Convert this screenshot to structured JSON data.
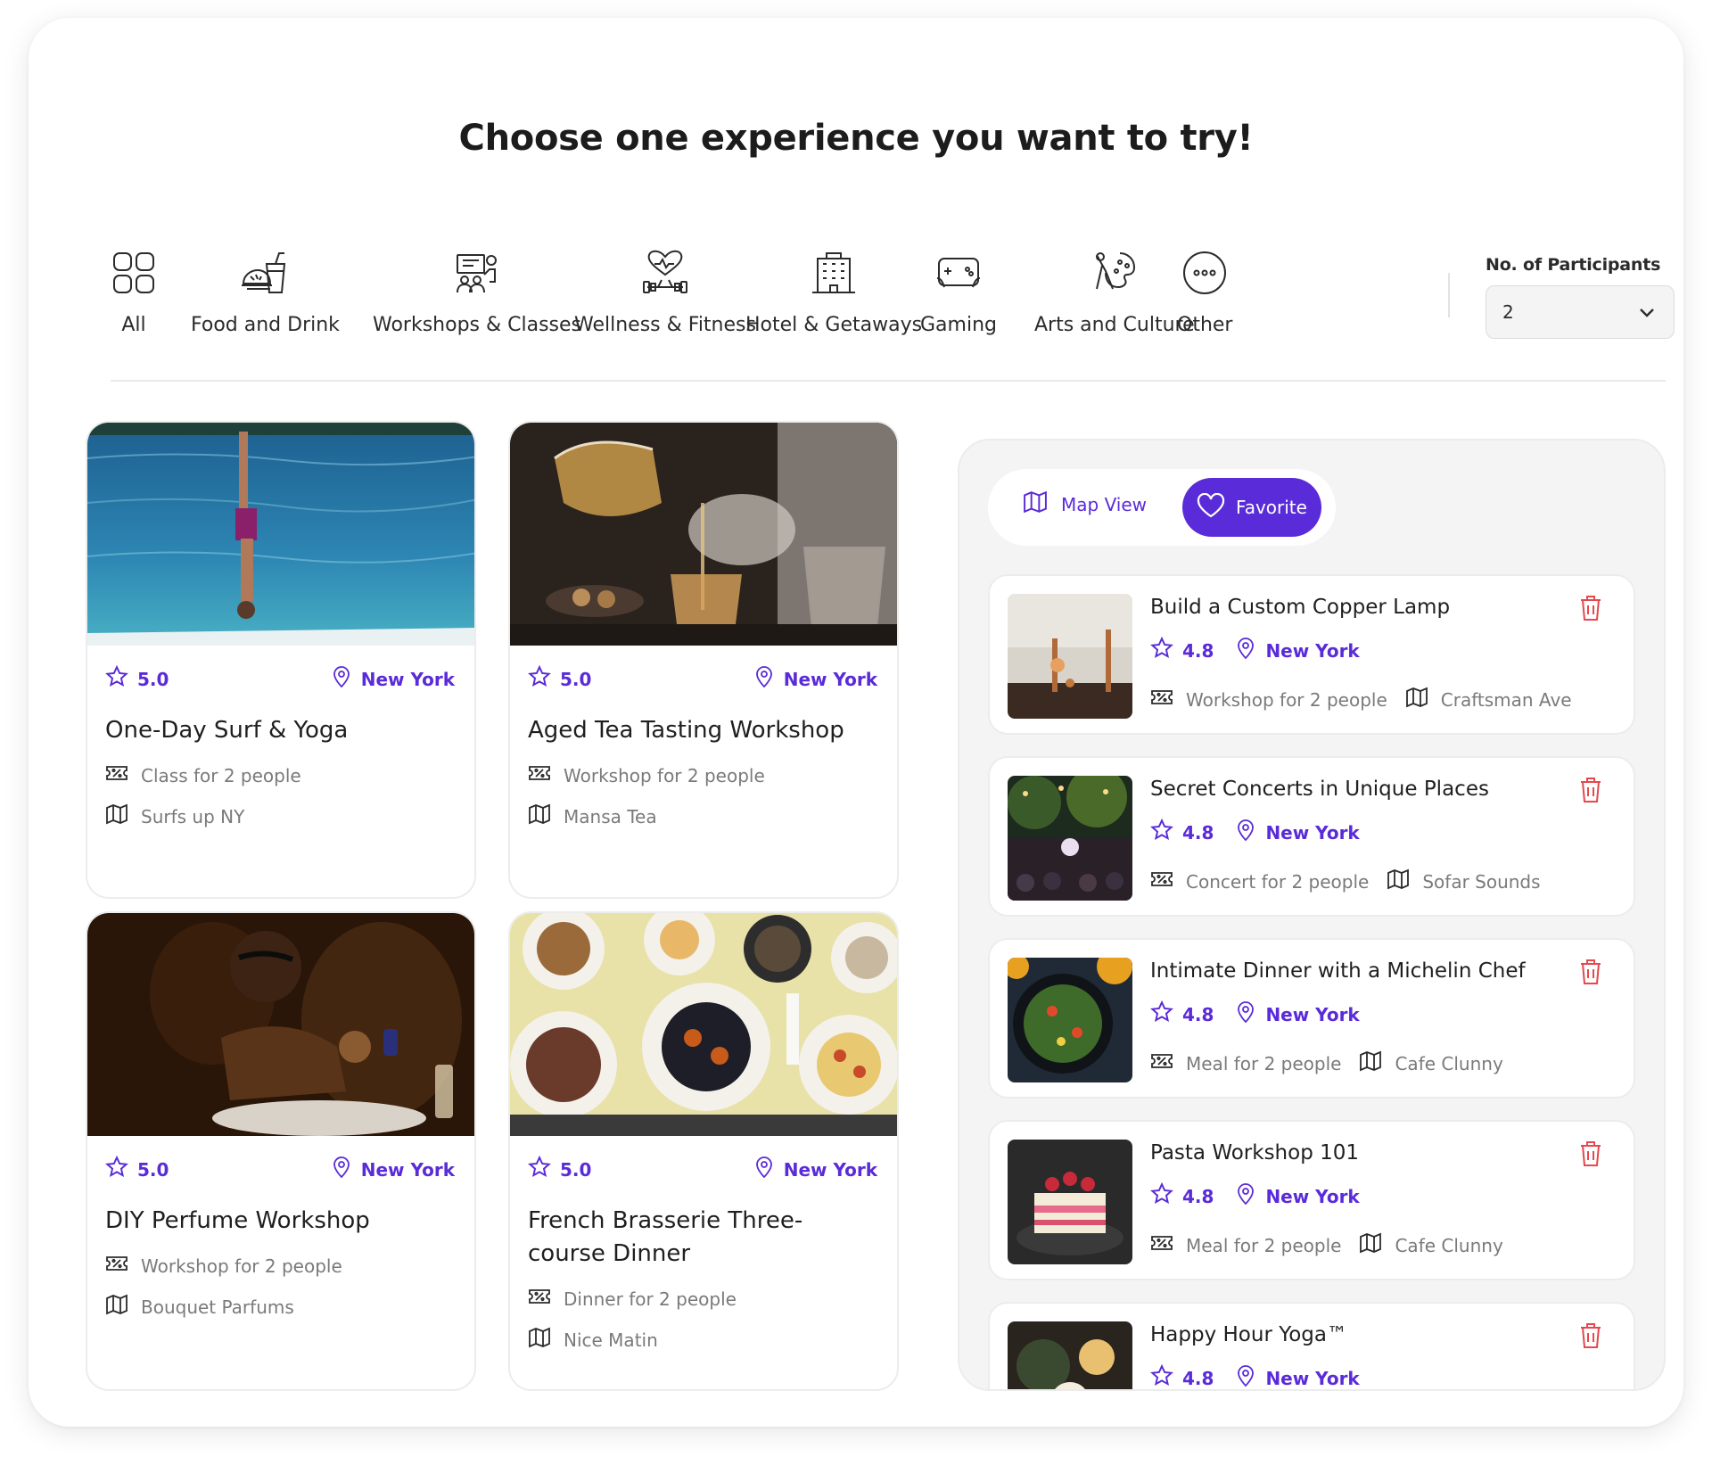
{
  "page_title": "Choose one experience you want to try!",
  "categories": [
    {
      "label": "All",
      "icon": "grid-icon"
    },
    {
      "label": "Food and Drink",
      "icon": "food-drink-icon"
    },
    {
      "label": "Workshops & Classes",
      "icon": "workshop-icon"
    },
    {
      "label": "Wellness & Fitness",
      "icon": "wellness-icon"
    },
    {
      "label": "Hotel & Getaways",
      "icon": "hotel-icon"
    },
    {
      "label": "Gaming",
      "icon": "gaming-icon"
    },
    {
      "label": "Arts and Culture",
      "icon": "arts-icon"
    },
    {
      "label": "Other",
      "icon": "more-icon"
    }
  ],
  "participants": {
    "label": "No. of Participants",
    "value": "2"
  },
  "cards": [
    {
      "rating": "5.0",
      "location": "New York",
      "title": "One-Day Surf & Yoga",
      "type": "Class for 2 people",
      "venue": "Surfs up NY"
    },
    {
      "rating": "5.0",
      "location": "New York",
      "title": "Aged Tea Tasting Workshop",
      "type": "Workshop for 2 people",
      "venue": "Mansa Tea"
    },
    {
      "rating": "5.0",
      "location": "New York",
      "title": "DIY Perfume Workshop",
      "type": "Workshop for 2 people",
      "venue": "Bouquet Parfums"
    },
    {
      "rating": "5.0",
      "location": "New York",
      "title": "French Brasserie Three-course Dinner",
      "type": "Dinner for 2 people",
      "venue": "Nice Matin"
    }
  ],
  "toggle": {
    "map_label": "Map View",
    "fav_label": "Favorite"
  },
  "favorites": [
    {
      "title": "Build a Custom Copper Lamp",
      "rating": "4.8",
      "location": "New York",
      "type": "Workshop for 2 people",
      "venue": "Craftsman Ave"
    },
    {
      "title": "Secret Concerts in Unique Places",
      "rating": "4.8",
      "location": "New York",
      "type": "Concert for 2 people",
      "venue": "Sofar Sounds"
    },
    {
      "title": "Intimate Dinner with a Michelin Chef",
      "rating": "4.8",
      "location": "New York",
      "type": "Meal for 2 people",
      "venue": "Cafe Clunny"
    },
    {
      "title": "Pasta Workshop 101",
      "rating": "4.8",
      "location": "New York",
      "type": "Meal for 2 people",
      "venue": "Cafe Clunny"
    },
    {
      "title": "Happy Hour Yoga™",
      "rating": "4.8",
      "location": "New York",
      "type": "",
      "venue": ""
    }
  ],
  "colors": {
    "accent": "#5a2bd8",
    "danger": "#e5484d",
    "muted": "#7a7a7a"
  }
}
